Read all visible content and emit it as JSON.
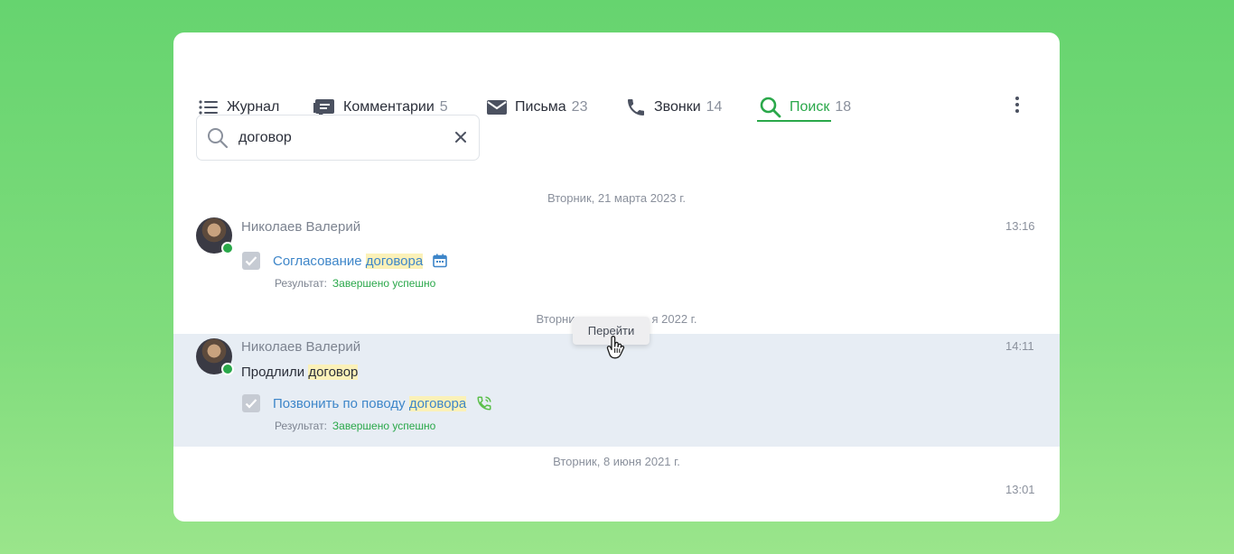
{
  "tabs": [
    {
      "label": "Журнал",
      "count": "",
      "icon": "list-icon"
    },
    {
      "label": "Комментарии",
      "count": "5",
      "icon": "comment-icon"
    },
    {
      "label": "Письма",
      "count": "23",
      "icon": "mail-icon"
    },
    {
      "label": "Звонки",
      "count": "14",
      "icon": "phone-icon"
    },
    {
      "label": "Поиск",
      "count": "18",
      "icon": "search-icon",
      "active": true
    }
  ],
  "search": {
    "value": "договор"
  },
  "feed": {
    "date1": "Вторник, 21 марта 2023 г.",
    "date2_left": "Вторни",
    "date2_right": "я 2022 г.",
    "date3": "Вторник, 8 июня 2021 г.",
    "tooltip": "Перейти",
    "entries": [
      {
        "author": "Николаев Валерий",
        "time": "13:16",
        "task_pre": "Согласование ",
        "task_hl": "договора",
        "result_label": "Результат:",
        "result_value": "Завершено успешно"
      },
      {
        "author": "Николаев Валерий",
        "time": "14:11",
        "comment_pre": "Продлили ",
        "comment_hl": "договор",
        "task_pre": "Позвонить по поводу ",
        "task_hl": "договора",
        "result_label": "Результат:",
        "result_value": "Завершено успешно"
      },
      {
        "time": "13:01"
      }
    ]
  },
  "colors": {
    "accent": "#2aa84a",
    "link": "#3e86c9",
    "highlight": "#fbf1b8",
    "row_selected": "#e7edf4"
  }
}
